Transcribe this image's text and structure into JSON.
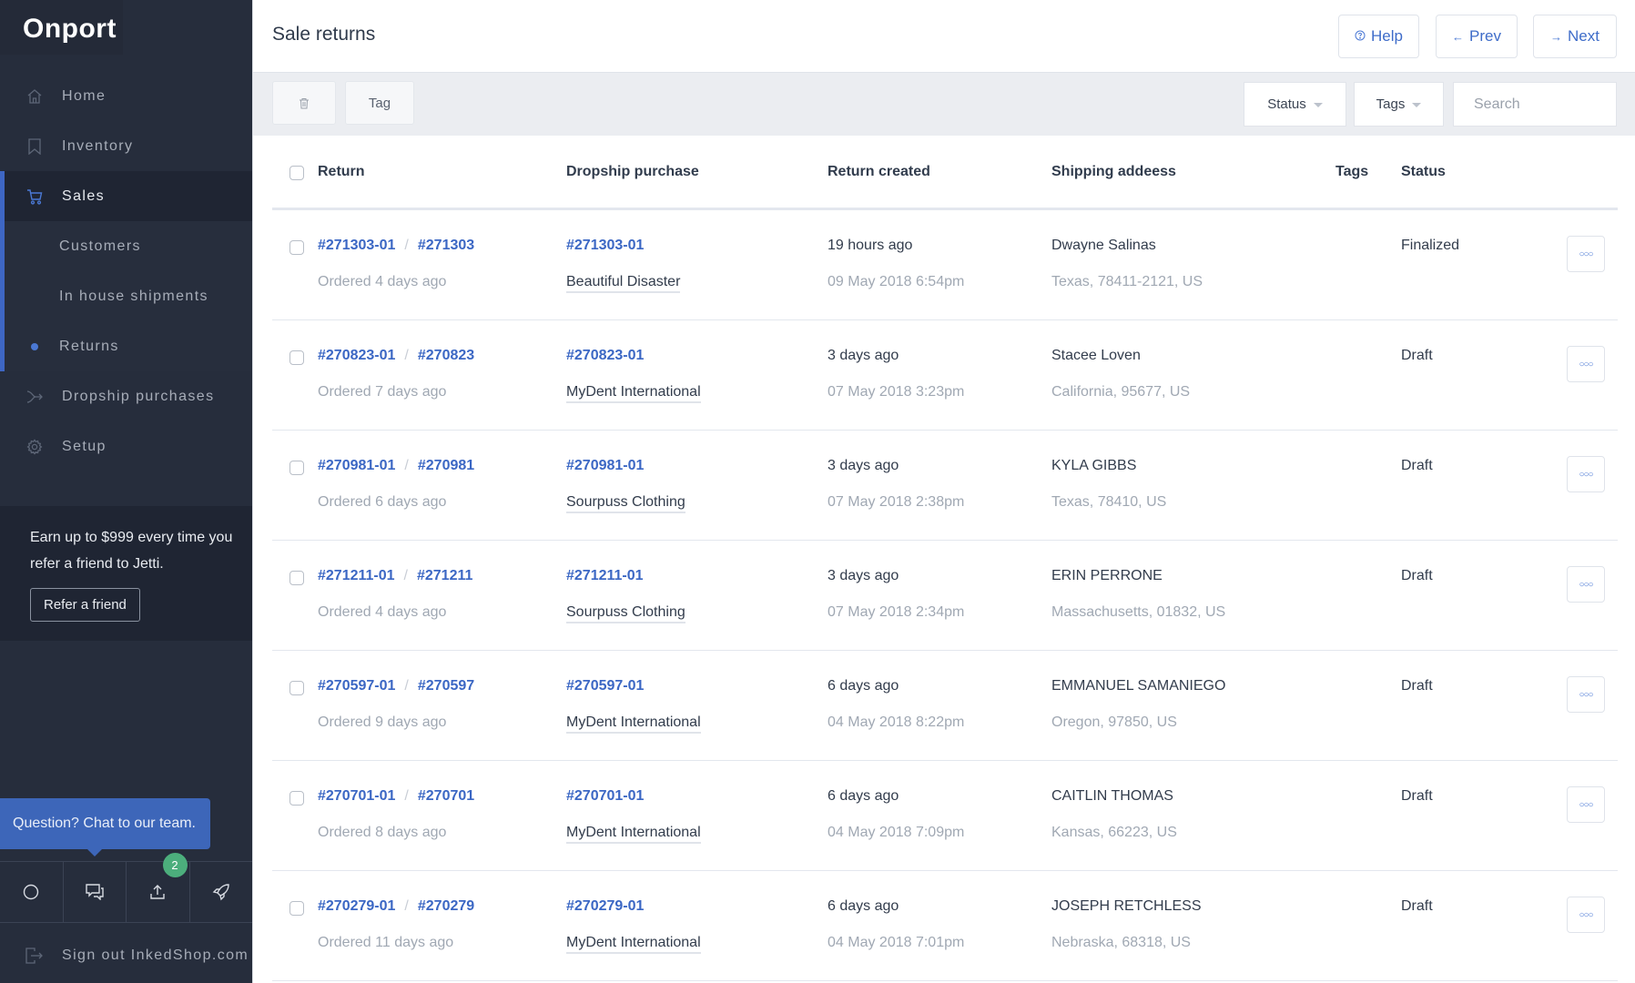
{
  "sidebar": {
    "logo": "Onport",
    "nav": [
      {
        "label": "Home",
        "icon": "home-icon"
      },
      {
        "label": "Inventory",
        "icon": "bookmark-icon"
      },
      {
        "label": "Sales",
        "icon": "cart-icon",
        "active": true
      }
    ],
    "sales_sub": [
      {
        "label": "Customers"
      },
      {
        "label": "In house shipments"
      },
      {
        "label": "Returns",
        "active": true
      }
    ],
    "nav_after": [
      {
        "label": "Dropship purchases",
        "icon": "merge-arrow-icon"
      },
      {
        "label": "Setup",
        "icon": "gear-icon"
      }
    ],
    "promo": {
      "text": "Earn up to $999 every time you refer a friend to Jetti.",
      "button": "Refer a friend"
    },
    "chat_tooltip": "Question? Chat to our team.",
    "icon_badge": "2",
    "signout": "Sign out InkedShop.com"
  },
  "header": {
    "title": "Sale returns",
    "help": "Help",
    "prev": "Prev",
    "next": "Next"
  },
  "toolbar": {
    "tag": "Tag",
    "status_filter": "Status",
    "tags_filter": "Tags",
    "search_placeholder": "Search"
  },
  "table": {
    "columns": [
      "Return",
      "Dropship purchase",
      "Return created",
      "Shipping addeess",
      "Tags",
      "Status"
    ],
    "rows": [
      {
        "return_id": "#271303-01",
        "order_id": "#271303",
        "ordered": "Ordered 4 days ago",
        "purchase_id": "#271303-01",
        "vendor": "Beautiful Disaster",
        "created": "19 hours ago",
        "created_date": "09 May 2018 6:54pm",
        "name": "Dwayne Salinas",
        "address": "Texas, 78411-2121, US",
        "tags": "",
        "status": "Finalized"
      },
      {
        "return_id": "#270823-01",
        "order_id": "#270823",
        "ordered": "Ordered 7 days ago",
        "purchase_id": "#270823-01",
        "vendor": "MyDent International",
        "created": "3 days ago",
        "created_date": "07 May 2018 3:23pm",
        "name": "Stacee Loven",
        "address": "California, 95677, US",
        "tags": "",
        "status": "Draft"
      },
      {
        "return_id": "#270981-01",
        "order_id": "#270981",
        "ordered": "Ordered 6 days ago",
        "purchase_id": "#270981-01",
        "vendor": "Sourpuss Clothing",
        "created": "3 days ago",
        "created_date": "07 May 2018 2:38pm",
        "name": "KYLA GIBBS",
        "address": "Texas, 78410, US",
        "tags": "",
        "status": "Draft"
      },
      {
        "return_id": "#271211-01",
        "order_id": "#271211",
        "ordered": "Ordered 4 days ago",
        "purchase_id": "#271211-01",
        "vendor": "Sourpuss Clothing",
        "created": "3 days ago",
        "created_date": "07 May 2018 2:34pm",
        "name": "ERIN PERRONE",
        "address": "Massachusetts, 01832, US",
        "tags": "",
        "status": "Draft"
      },
      {
        "return_id": "#270597-01",
        "order_id": "#270597",
        "ordered": "Ordered 9 days ago",
        "purchase_id": "#270597-01",
        "vendor": "MyDent International",
        "created": "6 days ago",
        "created_date": "04 May 2018 8:22pm",
        "name": "EMMANUEL SAMANIEGO",
        "address": "Oregon, 97850, US",
        "tags": "",
        "status": "Draft"
      },
      {
        "return_id": "#270701-01",
        "order_id": "#270701",
        "ordered": "Ordered 8 days ago",
        "purchase_id": "#270701-01",
        "vendor": "MyDent International",
        "created": "6 days ago",
        "created_date": "04 May 2018 7:09pm",
        "name": "CAITLIN THOMAS",
        "address": "Kansas, 66223, US",
        "tags": "",
        "status": "Draft"
      },
      {
        "return_id": "#270279-01",
        "order_id": "#270279",
        "ordered": "Ordered 11 days ago",
        "purchase_id": "#270279-01",
        "vendor": "MyDent International",
        "created": "6 days ago",
        "created_date": "04 May 2018 7:01pm",
        "name": "JOSEPH RETCHLESS",
        "address": "Nebraska, 68318, US",
        "tags": "",
        "status": "Draft"
      }
    ]
  },
  "colors": {
    "sidebar_bg": "#262d3c",
    "accent": "#3e66c3",
    "link": "#3b67c4",
    "badge": "#4cae7c"
  }
}
